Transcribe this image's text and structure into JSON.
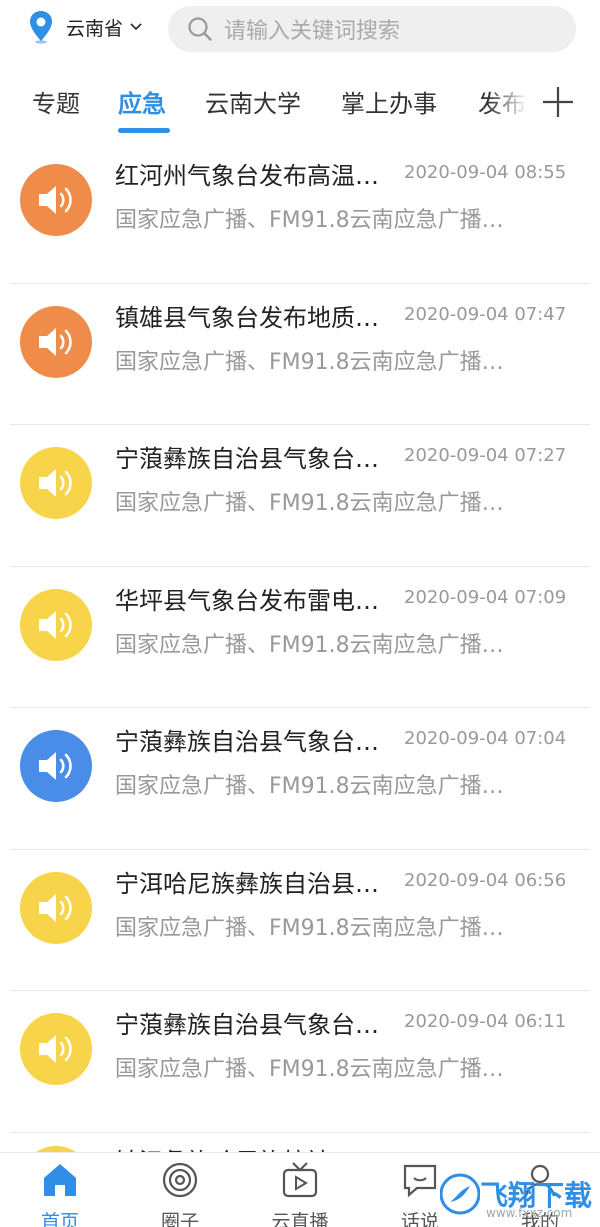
{
  "header": {
    "location": "云南省",
    "search_placeholder": "请输入关键词搜索"
  },
  "tabs": [
    {
      "label": "专题",
      "active": false
    },
    {
      "label": "应急",
      "active": true
    },
    {
      "label": "云南大学",
      "active": false
    },
    {
      "label": "掌上办事",
      "active": false
    },
    {
      "label": "发布",
      "active": false
    }
  ],
  "colors": {
    "accent": "#2f8ee6",
    "orange": "#ef8c4a",
    "yellow": "#f7d44a",
    "blue": "#4a8de8"
  },
  "items": [
    {
      "title": "红河州气象台发布高温…",
      "time": "2020-09-04 08:55",
      "source": "国家应急广播、FM91.8云南应急广播…",
      "icon": "speaker-icon",
      "color": "orange"
    },
    {
      "title": "镇雄县气象台发布地质…",
      "time": "2020-09-04 07:47",
      "source": "国家应急广播、FM91.8云南应急广播…",
      "icon": "speaker-icon",
      "color": "orange"
    },
    {
      "title": "宁蒗彝族自治县气象台…",
      "time": "2020-09-04 07:27",
      "source": "国家应急广播、FM91.8云南应急广播…",
      "icon": "speaker-icon",
      "color": "yellow"
    },
    {
      "title": "华坪县气象台发布雷电…",
      "time": "2020-09-04 07:09",
      "source": "国家应急广播、FM91.8云南应急广播…",
      "icon": "speaker-icon",
      "color": "yellow"
    },
    {
      "title": "宁蒗彝族自治县气象台…",
      "time": "2020-09-04 07:04",
      "source": "国家应急广播、FM91.8云南应急广播…",
      "icon": "speaker-icon",
      "color": "blue"
    },
    {
      "title": "宁洱哈尼族彝族自治县…",
      "time": "2020-09-04 06:56",
      "source": "国家应急广播、FM91.8云南应急广播…",
      "icon": "speaker-icon",
      "color": "yellow"
    },
    {
      "title": "宁蒗彝族自治县气象台…",
      "time": "2020-09-04 06:11",
      "source": "国家应急广播、FM91.8云南应急广播…",
      "icon": "speaker-icon",
      "color": "yellow"
    }
  ],
  "peek_title": "镇沅彝族哈尼族拉祜…",
  "bottom_nav": [
    {
      "label": "首页",
      "icon": "home-icon",
      "active": true
    },
    {
      "label": "圈子",
      "icon": "circle-icon",
      "active": false
    },
    {
      "label": "云直播",
      "icon": "tv-icon",
      "active": false
    },
    {
      "label": "话说",
      "icon": "chat-icon",
      "active": false
    },
    {
      "label": "我的",
      "icon": "user-icon",
      "active": false
    }
  ],
  "watermark": {
    "text": "飞翔下载",
    "url": "www.fxxz.com"
  }
}
